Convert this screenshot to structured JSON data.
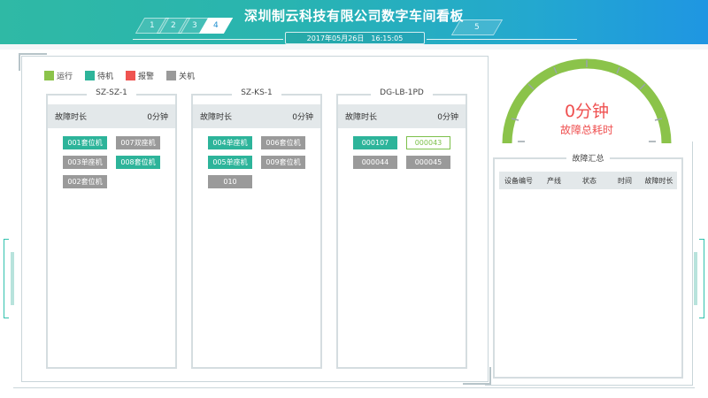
{
  "header": {
    "title": "深圳制云科技有限公司数字车间看板",
    "date": "2017年05月26日",
    "time": "16:15:05",
    "tabs_left": [
      "1",
      "2",
      "3",
      "4"
    ],
    "tabs_right": [
      "5"
    ],
    "active_tab": "4"
  },
  "legend": [
    {
      "label": "运行",
      "color": "#8bc34a"
    },
    {
      "label": "待机",
      "color": "#2db49a"
    },
    {
      "label": "报警",
      "color": "#ef5350"
    },
    {
      "label": "关机",
      "color": "#9a9a9a"
    }
  ],
  "groups": [
    {
      "name": "SZ-SZ-1",
      "fault_label": "故障时长",
      "fault_value": "0分钟",
      "machines": [
        {
          "label": "001套位机",
          "status": "run"
        },
        {
          "label": "007双座机",
          "status": "off"
        },
        {
          "label": "003单座机",
          "status": "off"
        },
        {
          "label": "008套位机",
          "status": "run"
        },
        {
          "label": "002套位机",
          "status": "off"
        }
      ]
    },
    {
      "name": "SZ-KS-1",
      "fault_label": "故障时长",
      "fault_value": "0分钟",
      "machines": [
        {
          "label": "004单座机",
          "status": "run"
        },
        {
          "label": "006套位机",
          "status": "off"
        },
        {
          "label": "005单座机",
          "status": "run"
        },
        {
          "label": "009套位机",
          "status": "off"
        },
        {
          "label": "010",
          "status": "off"
        }
      ]
    },
    {
      "name": "DG-LB-1PD",
      "fault_label": "故障时长",
      "fault_value": "0分钟",
      "machines": [
        {
          "label": "000107",
          "status": "run"
        },
        {
          "label": "000043",
          "status": "standby"
        },
        {
          "label": "000044",
          "status": "off"
        },
        {
          "label": "000045",
          "status": "off"
        }
      ]
    }
  ],
  "gauge": {
    "value": "0分钟",
    "label": "故障总耗时",
    "arc_color": "#8bc34a",
    "value_color": "#ef4f4f"
  },
  "summary": {
    "title": "故障汇总",
    "columns": [
      "设备编号",
      "产线",
      "状态",
      "时间",
      "故障时长"
    ]
  }
}
